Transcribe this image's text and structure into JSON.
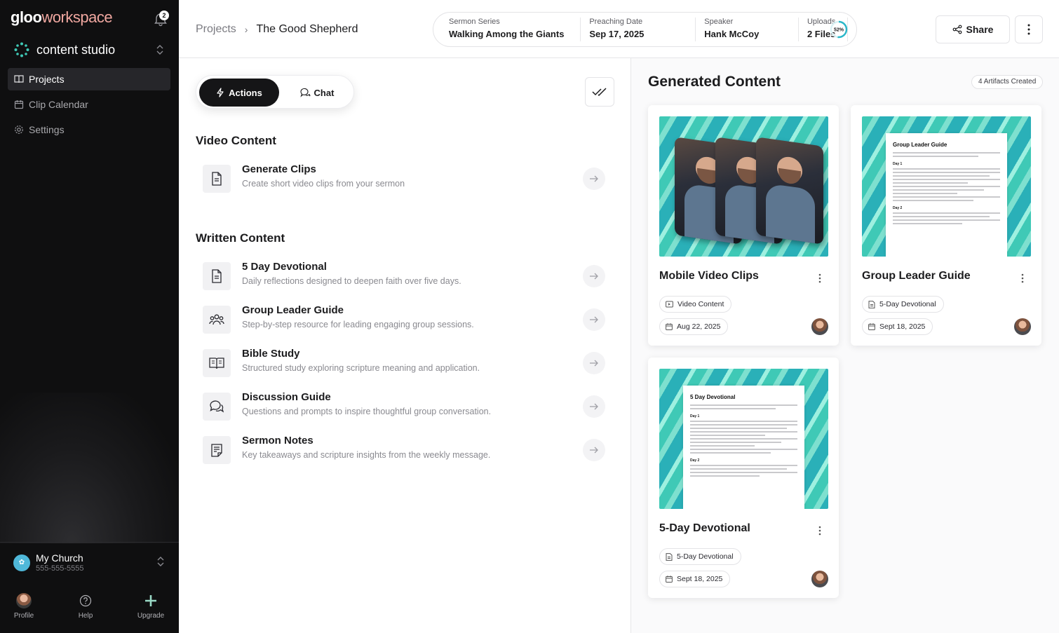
{
  "sidebar": {
    "brand_primary": "gloo",
    "brand_secondary": "workspace",
    "notification_count": "2",
    "studio_title": "content studio",
    "nav": [
      {
        "label": "Projects",
        "icon": "book-open-icon",
        "active": true
      },
      {
        "label": "Clip Calendar",
        "icon": "calendar-icon",
        "active": false
      },
      {
        "label": "Settings",
        "icon": "gear-icon",
        "active": false
      }
    ],
    "church": {
      "name": "My Church",
      "phone": "555-555-5555"
    },
    "bottom": {
      "profile": "Profile",
      "help": "Help",
      "upgrade": "Upgrade"
    }
  },
  "header": {
    "breadcrumb_root": "Projects",
    "breadcrumb_current": "The Good Shepherd",
    "sermon_series_label": "Sermon Series",
    "sermon_series": "Walking Among the Giants",
    "preaching_date_label": "Preaching Date",
    "preaching_date": "Sep 17, 2025",
    "speaker_label": "Speaker",
    "speaker": "Hank McCoy",
    "uploads_label": "Uploads",
    "uploads": "2 Files",
    "upload_progress_text": "52%",
    "upload_progress": 0.52,
    "share_label": "Share"
  },
  "actions_panel": {
    "tab_actions": "Actions",
    "tab_chat": "Chat",
    "video_section": "Video Content",
    "written_section": "Written Content",
    "video_items": [
      {
        "title": "Generate Clips",
        "desc": "Create short video clips from your sermon",
        "icon": "document-icon"
      }
    ],
    "written_items": [
      {
        "title": "5 Day Devotional",
        "desc": "Daily reflections designed to deepen faith over five days.",
        "icon": "document-icon"
      },
      {
        "title": "Group Leader Guide",
        "desc": "Step-by-step resource for leading engaging group sessions.",
        "icon": "group-icon"
      },
      {
        "title": "Bible Study",
        "desc": "Structured study exploring scripture meaning and application.",
        "icon": "open-book-icon"
      },
      {
        "title": "Discussion Guide",
        "desc": "Questions and prompts to inspire thoughtful group conversation.",
        "icon": "chat-bubbles-icon"
      },
      {
        "title": "Sermon Notes",
        "desc": "Key takeaways and scripture insights from the weekly message.",
        "icon": "notes-icon"
      }
    ]
  },
  "generated": {
    "title": "Generated Content",
    "artifacts_badge": "4 Artifacts Created",
    "cards": [
      {
        "title": "Mobile Video Clips",
        "tag": "Video Content",
        "date": "Aug 22, 2025",
        "thumb": "phones"
      },
      {
        "title": "Group Leader Guide",
        "tag": "5-Day Devotional",
        "date": "Sept 18, 2025",
        "thumb": "doc",
        "doc_title": "Group Leader Guide",
        "day1": "Day 1",
        "day2": "Day 2"
      },
      {
        "title": "5-Day Devotional",
        "tag": "5-Day Devotional",
        "date": "Sept 18, 2025",
        "thumb": "doc",
        "doc_title": "5 Day Devotional",
        "day1": "Day 1",
        "day2": "Day 2"
      }
    ]
  },
  "colors": {
    "sidebar_bg": "#0f0f10",
    "accent_teal": "#3fc9b6",
    "brand_secondary": "#f0a7a0",
    "progress": "#2ab7c9"
  }
}
